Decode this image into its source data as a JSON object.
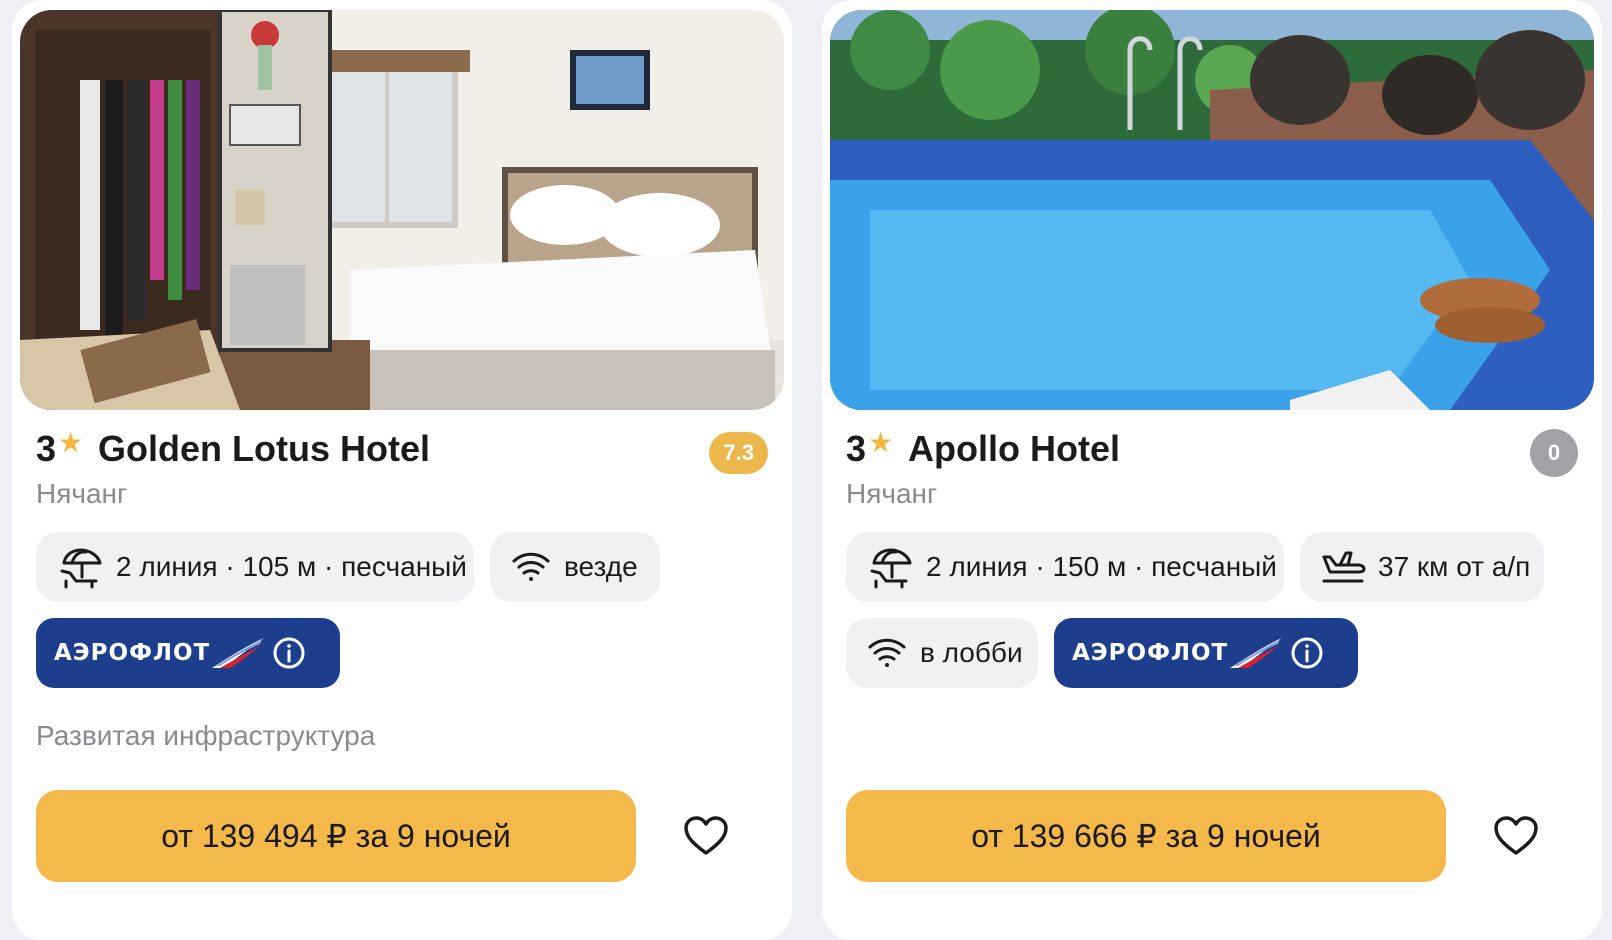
{
  "colors": {
    "accent": "#f4b94a",
    "rating_gold": "#ecb84b",
    "rating_gray": "#a1a1a6",
    "aeroflot_blue": "#1c3e8c",
    "chip_bg": "#f1f1f4"
  },
  "hotels": [
    {
      "stars": "3",
      "name": "Golden Lotus Hotel",
      "rating": "7.3",
      "city": "Нячанг",
      "beach": "2 линия · 105 м · песчаный",
      "wifi": "везде",
      "airline": "АЭРОФЛОТ",
      "feature": "Развитая инфраструктура",
      "price": "от 139 494 ₽ за 9 ночей",
      "photo_icon": "hotel-room-photo"
    },
    {
      "stars": "3",
      "name": "Apollo Hotel",
      "rating": "0",
      "city": "Нячанг",
      "beach": "2 линия · 150 м · песчаный",
      "airport": "37 км от а/п",
      "wifi": "в лобби",
      "airline": "АЭРОФЛОТ",
      "price": "от 139 666 ₽ за 9 ночей",
      "photo_icon": "rooftop-pool-photo"
    }
  ]
}
